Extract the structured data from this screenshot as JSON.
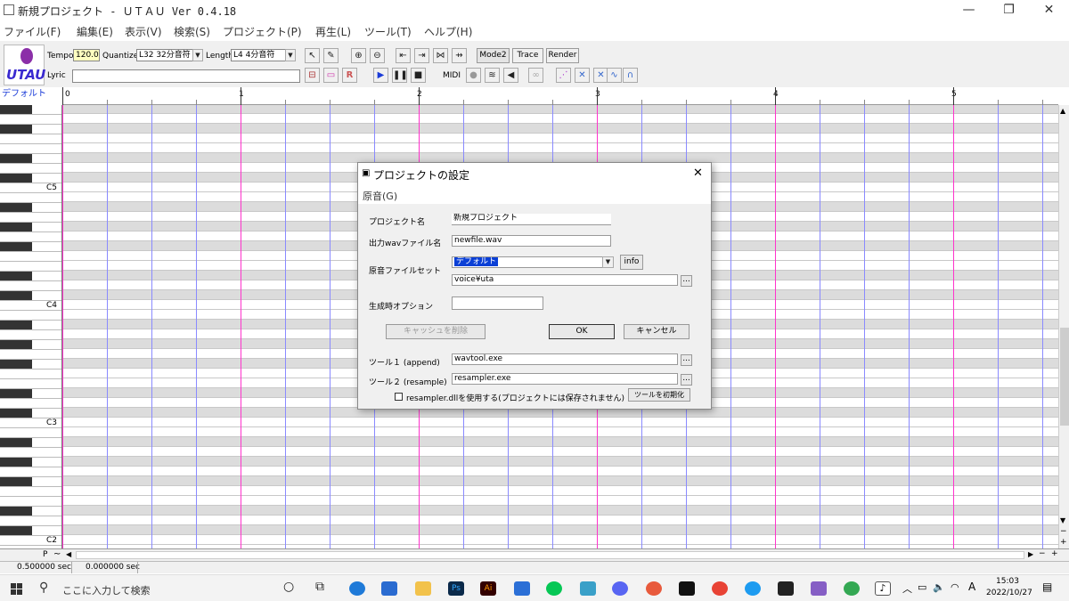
{
  "window": {
    "title": "新規プロジェクト - ＵＴＡＵ Ver 0.4.18",
    "minimize": "—",
    "maximize": "❐",
    "close": "✕"
  },
  "menu": [
    "ファイル(F)",
    "編集(E)",
    "表示(V)",
    "検索(S)",
    "プロジェクト(P)",
    "再生(L)",
    "ツール(T)",
    "ヘルプ(H)"
  ],
  "logo": {
    "text": "UTAU"
  },
  "toolbar": {
    "tempo_label": "Tempo",
    "tempo_value": "120.0",
    "quantize_label": "Quantize",
    "quantize_value": "L32 32分音符",
    "length_label": "Length",
    "length_value": "L4  4分音符",
    "lyric_label": "Lyric",
    "lyric_value": "",
    "mode2": "Mode2",
    "trace": "Trace",
    "render": "Render",
    "midi": "MIDI"
  },
  "track": {
    "voice_label": "デフォルト"
  },
  "ruler": {
    "measures": [
      "0",
      "1",
      "2",
      "3",
      "4",
      "5"
    ]
  },
  "piano": {
    "octaves": [
      "C5",
      "C4",
      "C3",
      "C2"
    ]
  },
  "bottombar": {
    "p_label": "P",
    "tilde": "~"
  },
  "status": {
    "left": "0.500000 sec",
    "right": "0.000000 sec"
  },
  "taskbar": {
    "search_placeholder": "ここに入力して検索",
    "time": "15:03",
    "date": "2022/10/27",
    "ime": "A"
  },
  "dialog": {
    "title": "プロジェクトの設定",
    "menu": "原音(G)",
    "project_name_label": "プロジェクト名",
    "project_name_value": "新規プロジェクト",
    "wav_label": "出力wavファイル名",
    "wav_value": "newfile.wav",
    "voiceset_label": "原音ファイルセット",
    "voiceset_value": "デフォルト",
    "info_button": "info",
    "voice_path": "voice¥uta",
    "browse": "...",
    "options_label": "生成時オプション",
    "options_value": "",
    "clear_cache_button": "キャッシュを削除",
    "ok_button": "OK",
    "cancel_button": "キャンセル",
    "tool1_label": "ツール１ (append)",
    "tool1_value": "wavtool.exe",
    "tool2_label": "ツール２ (resample)",
    "tool2_value": "resampler.exe",
    "dll_checkbox_label": "resampler.dllを使用する(プロジェクトには保存されません)",
    "init_tools_button": "ツールを初期化"
  },
  "colors": {
    "measure_line": "#ff33cc",
    "beat_line": "#8a8aff",
    "black_key_row": "#dcdcdc",
    "accent": "#1a3bd8"
  }
}
